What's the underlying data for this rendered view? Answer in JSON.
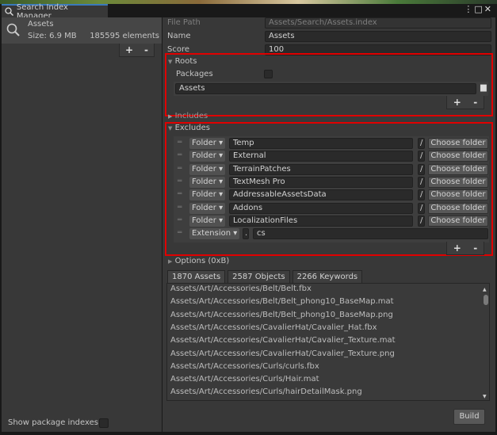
{
  "window": {
    "title": "Search Index Manager",
    "menu_icon": "kebab-icon",
    "maximize_icon": "maximize-icon",
    "close_icon": "close-icon"
  },
  "index_list": {
    "items": [
      {
        "name": "Assets",
        "size": "Size: 6.9 MB",
        "elements": "185595 elements"
      }
    ],
    "add": "+",
    "remove": "-"
  },
  "properties": {
    "file_path_label": "File Path",
    "file_path": "Assets/Search/Assets.index",
    "name_label": "Name",
    "name": "Assets",
    "score_label": "Score",
    "score": "100"
  },
  "roots": {
    "title": "Roots",
    "packages_label": "Packages",
    "packages_checked": false,
    "items": [
      "Assets"
    ],
    "add": "+",
    "remove": "-"
  },
  "includes": {
    "title": "Includes"
  },
  "excludes": {
    "title": "Excludes",
    "items": [
      {
        "type": "Folder",
        "value": "Temp",
        "sep": "/",
        "button": "Choose folder"
      },
      {
        "type": "Folder",
        "value": "External",
        "sep": "/",
        "button": "Choose folder"
      },
      {
        "type": "Folder",
        "value": "TerrainPatches",
        "sep": "/",
        "button": "Choose folder"
      },
      {
        "type": "Folder",
        "value": "TextMesh Pro",
        "sep": "/",
        "button": "Choose folder"
      },
      {
        "type": "Folder",
        "value": "AddressableAssetsData",
        "sep": "/",
        "button": "Choose folder"
      },
      {
        "type": "Folder",
        "value": "Addons",
        "sep": "/",
        "button": "Choose folder"
      },
      {
        "type": "Folder",
        "value": "LocalizationFiles",
        "sep": "/",
        "button": "Choose folder"
      }
    ],
    "extension": {
      "type": "Extension",
      "sep": ".",
      "value": "cs"
    },
    "add": "+",
    "remove": "-"
  },
  "options": {
    "title": "Options (0xB)"
  },
  "tabs": [
    {
      "label": "1870 Assets",
      "active": true
    },
    {
      "label": "2587 Objects"
    },
    {
      "label": "2266 Keywords"
    }
  ],
  "assets": [
    "Assets/Art/Accessories/Belt/Belt.fbx",
    "Assets/Art/Accessories/Belt/Belt_phong10_BaseMap.mat",
    "Assets/Art/Accessories/Belt/Belt_phong10_BaseMap.png",
    "Assets/Art/Accessories/CavalierHat/Cavalier_Hat.fbx",
    "Assets/Art/Accessories/CavalierHat/Cavalier_Texture.mat",
    "Assets/Art/Accessories/CavalierHat/Cavalier_Texture.png",
    "Assets/Art/Accessories/Curls/curls.fbx",
    "Assets/Art/Accessories/Curls/Hair.mat",
    "Assets/Art/Accessories/Curls/hairDetailMask.png"
  ],
  "build": "Build",
  "footer": {
    "show_packages_label": "Show package indexes",
    "show_packages_checked": false
  },
  "colors": {
    "highlight": "#e00000",
    "tab_accent": "#3a79bb"
  }
}
